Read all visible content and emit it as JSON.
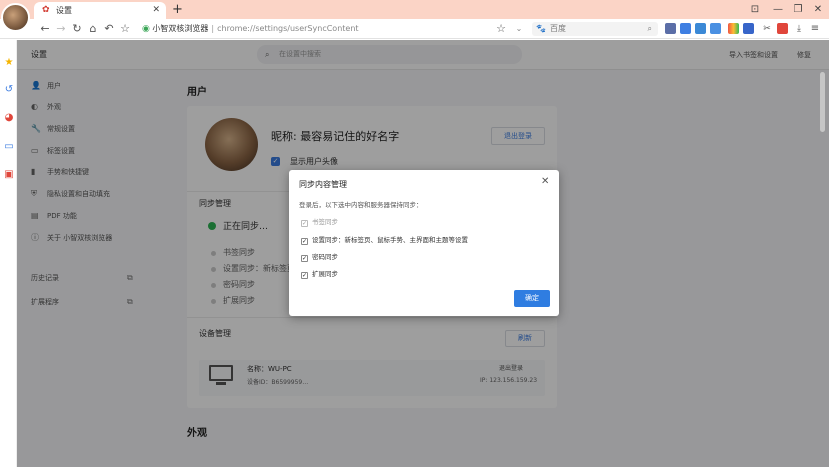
{
  "browser": {
    "tab": {
      "title": "设置",
      "icon": "gear-icon"
    },
    "new_tab": "+",
    "window_controls": [
      "⊡",
      "—",
      "❐",
      "✕"
    ],
    "address": {
      "host": "小智双核浏览器",
      "separator": "|",
      "path": "chrome://settings/userSyncContent"
    },
    "search_engine": "百度"
  },
  "settings": {
    "header_title": "设置",
    "search_placeholder": "在设置中搜索",
    "import_link": "导入书签和设置",
    "repair_link": "修复",
    "sidebar": [
      {
        "icon": "user-icon",
        "label": "用户"
      },
      {
        "icon": "palette-icon",
        "label": "外观"
      },
      {
        "icon": "wrench-icon",
        "label": "常规设置"
      },
      {
        "icon": "tab-icon",
        "label": "标签设置"
      },
      {
        "icon": "phone-icon",
        "label": "手势和快捷键"
      },
      {
        "icon": "shield-icon",
        "label": "隐私设置和自动填充"
      },
      {
        "icon": "pdf-icon",
        "label": "PDF 功能"
      },
      {
        "icon": "info-icon",
        "label": "关于 小智双核浏览器"
      }
    ],
    "sidebar_links": [
      {
        "label": "历史记录",
        "icon": "external-link-icon"
      },
      {
        "label": "扩展程序",
        "icon": "external-link-icon"
      }
    ],
    "section_user": "用户",
    "nickname": "昵称: 最容易记住的好名字",
    "logout_button": "退出登录",
    "show_avatar": "显示用户头像",
    "sync_manage": "同步管理",
    "syncing": "正在同步…",
    "sync_items": [
      "书签同步",
      "设置同步：新标签页、…",
      "密码同步",
      "扩展同步"
    ],
    "device_manage": "设备管理",
    "refresh_button": "刷新",
    "device": {
      "name": "名称：WU-PC",
      "id": "设备ID：B6599959…",
      "logout": "退出登录",
      "ip": "IP: 123.156.159.23"
    },
    "section_appearance": "外观"
  },
  "dialog": {
    "title": "同步内容管理",
    "close": "✕",
    "description": "登录后，以下选中内容和服务器保持同步：",
    "items": [
      {
        "label": "书签同步",
        "checked": true,
        "disabled": true
      },
      {
        "label": "设置同步：新标签页、鼠标手势、主界面和主题等设置",
        "checked": true,
        "disabled": false
      },
      {
        "label": "密码同步",
        "checked": true,
        "disabled": false
      },
      {
        "label": "扩展同步",
        "checked": true,
        "disabled": false
      }
    ],
    "ok_button": "确定"
  }
}
